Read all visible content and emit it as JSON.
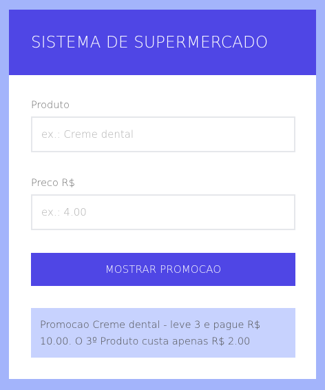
{
  "header": {
    "title": "SISTEMA DE SUPERMERCADO"
  },
  "form": {
    "produto_label": "Produto",
    "produto_placeholder": "ex.: Creme dental",
    "produto_value": "",
    "preco_label": "Preco R$",
    "preco_placeholder": "ex.: 4.00",
    "preco_value": "",
    "submit_label": "MOSTRAR PROMOCAO"
  },
  "result": {
    "text": "Promocao Creme dental - leve 3 e pague R$ 10.00. O 3º Produto custa apenas R$ 2.00"
  },
  "colors": {
    "page_background": "#a3b4fb",
    "header_background": "#4f46e5",
    "button_background": "#4f46e5",
    "result_background": "#c7d2fe"
  }
}
